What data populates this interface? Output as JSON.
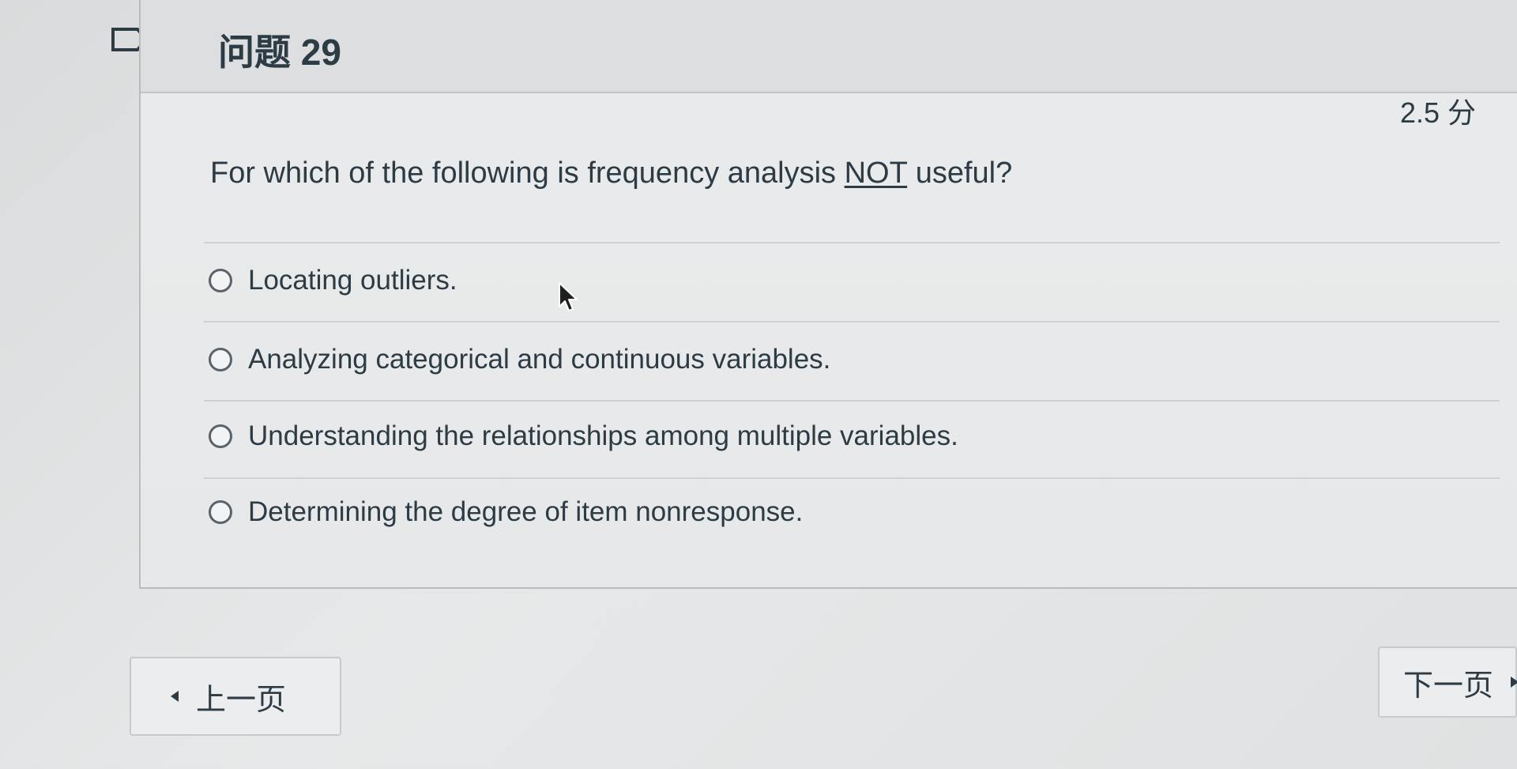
{
  "question": {
    "title": "问题 29",
    "points": "2.5 分",
    "text_before": "For which of the following is frequency analysis ",
    "text_emphasis": "NOT",
    "text_after": " useful?"
  },
  "answers": [
    {
      "label": "Locating outliers.",
      "selected": false
    },
    {
      "label": "Analyzing categorical and continuous variables.",
      "selected": false
    },
    {
      "label": "Understanding the relationships among multiple variables.",
      "selected": false
    },
    {
      "label": "Determining the degree of item nonresponse.",
      "selected": false
    }
  ],
  "nav": {
    "prev_label": "上一页",
    "next_label": "下一页"
  },
  "icons": {
    "flag": "flag-icon",
    "cursor": "mouse-pointer-icon",
    "prev": "triangle-left-icon",
    "next": "triangle-right-icon"
  },
  "colors": {
    "text": "#2d3b45",
    "header_bg": "#dcdedf",
    "card_bg": "#e7e9ea",
    "border": "#b9bcbe"
  }
}
